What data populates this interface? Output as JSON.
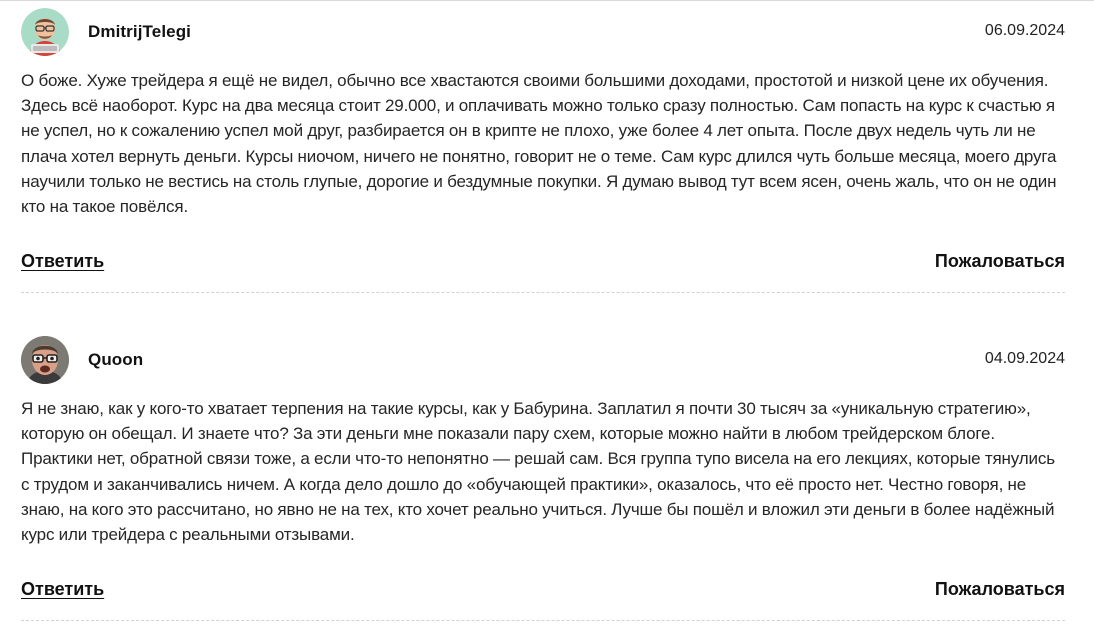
{
  "comments": [
    {
      "author": "DmitrijTelegi",
      "date": "06.09.2024",
      "avatar_icon": "cartoon-man-avatar-icon",
      "text": "О боже. Хуже трейдера я ещё не видел, обычно все хвастаются своими большими доходами, простотой и низкой цене их обучения. Здесь всё наоборот. Курс на два месяца стоит 29.000, и оплачивать можно только сразу полностью. Сам попасть на курс к счастью я не успел, но к сожалению успел мой друг, разбирается он в крипте не плохо, уже более 4 лет опыта. После двух недель чуть ли не плача хотел вернуть деньги. Курсы ниочом, ничего не понятно, говорит не о теме. Сам курс длился чуть больше месяца, моего друга научили только не вестись на столь глупые, дорогие и бездумные покупки. Я думаю вывод тут всем ясен, очень жаль, что он не один кто на такое повёлся.",
      "reply_label": "Ответить",
      "report_label": "Пожаловаться"
    },
    {
      "author": "Quoon",
      "date": "04.09.2024",
      "avatar_icon": "man-with-glasses-avatar-icon",
      "text": "Я не знаю, как у кого-то хватает терпения на такие курсы, как у Бабурина. Заплатил я почти 30 тысяч за «уникальную стратегию», которую он обещал. И знаете что? За эти деньги мне показали пару схем, которые можно найти в любом трейдерском блоге. Практики нет, обратной связи тоже, а если что-то непонятно — решай сам. Вся группа тупо висела на его лекциях, которые тянулись с трудом и заканчивались ничем. А когда дело дошло до «обучающей практики», оказалось, что её просто нет. Честно говоря, не знаю, на кого это рассчитано, но явно не на тех, кто хочет реально учиться. Лучше бы пошёл и вложил эти деньги в более надёжный курс или трейдера с реальными отзывами.",
      "reply_label": "Ответить",
      "report_label": "Пожаловаться"
    }
  ]
}
